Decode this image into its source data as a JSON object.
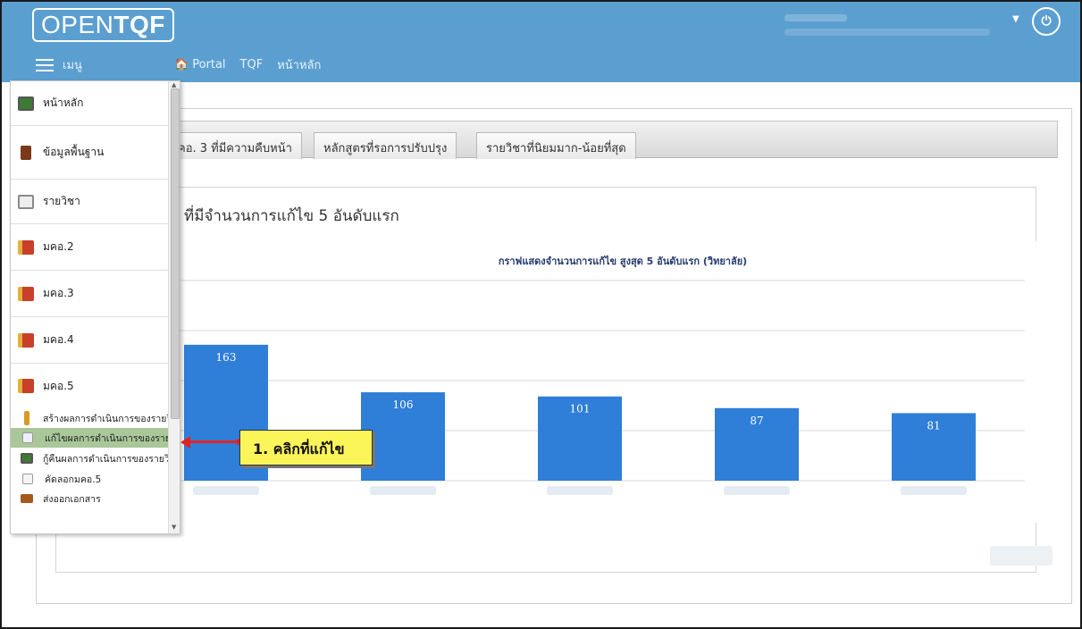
{
  "header": {
    "logo_light": "OPEN",
    "logo_bold": "TQF",
    "menu_label": "เมนู",
    "nav": [
      "Portal",
      "TQF",
      "หน้าหลัก"
    ]
  },
  "tabs": [
    "คอ. 3 ที่มีความคืบหน้า",
    "หลักสูตรที่รอการปรับปรุง",
    "รายวิชาที่นิยมมาก-น้อยที่สุด"
  ],
  "panel_title": "ที่มีจำนวนการแก้ไข 5 อันดับแรก",
  "sidebar": {
    "items": [
      {
        "label": "หน้าหลัก",
        "icon": "monitor-icon",
        "color": "#3f7a34"
      },
      {
        "label": "ข้อมูลพื้นฐาน",
        "icon": "book-icon",
        "color": "#7a3a18"
      },
      {
        "label": "รายวิชา",
        "icon": "door-icon",
        "color": "#8a8a8a"
      },
      {
        "label": "มคอ.2",
        "icon": "book-icon",
        "color": "#c8402a"
      },
      {
        "label": "มคอ.3",
        "icon": "book-icon",
        "color": "#c8402a"
      },
      {
        "label": "มคอ.4",
        "icon": "book-icon",
        "color": "#c8402a"
      },
      {
        "label": "มคอ.5",
        "icon": "book-icon",
        "color": "#c8402a"
      }
    ],
    "subitems": [
      {
        "label": "สร้างผลการดำเนินการของรายวิ",
        "icon": "pencil-icon",
        "color": "#d79c26"
      },
      {
        "label": "แก้ไขผลการดำเนินการของรายวิ",
        "icon": "edit-icon",
        "color": "#9a9a9a",
        "active": true
      },
      {
        "label": "กู้คืนผลการดำเนินการของรายวิ",
        "icon": "monitor-icon",
        "color": "#3f7a34"
      },
      {
        "label": "คัดลอกมคอ.5",
        "icon": "edit-icon",
        "color": "#9a9a9a"
      },
      {
        "label": "ส่งออกเอกสาร",
        "icon": "briefcase-icon",
        "color": "#a35a1a"
      }
    ]
  },
  "callout": {
    "text": "1. คลิกที่แก้ไข"
  },
  "chart_data": {
    "type": "bar",
    "title": "กราฟแสดงจำนวนการแก้ไข สูงสุด 5 อันดับแรก (วิทยาลัย)",
    "values": [
      163,
      106,
      101,
      87,
      81
    ],
    "ylim": [
      0,
      240
    ],
    "grid": true,
    "color": "#2f7ed8"
  }
}
